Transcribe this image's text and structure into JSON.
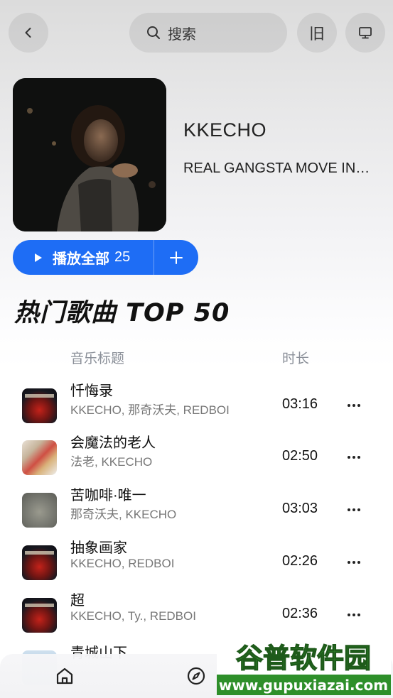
{
  "header": {
    "search_label": "搜索",
    "old_label": "旧",
    "icons": {
      "back": "chevron-left-icon",
      "search": "search-icon",
      "screen": "monitor-icon"
    }
  },
  "album": {
    "artist": "KKECHO",
    "title": "REAL GANGSTA MOVE IN…"
  },
  "play_all": {
    "label": "播放全部",
    "count": "25"
  },
  "section_title": "热门歌曲 TOP 50",
  "columns": {
    "title": "音乐标题",
    "duration": "时长"
  },
  "songs": [
    {
      "name": "忏悔录",
      "artists": "KKECHO, 那奇沃夫, REDBOI",
      "duration": "03:16"
    },
    {
      "name": "会魔法的老人",
      "artists": "法老, KKECHO",
      "duration": "02:50"
    },
    {
      "name": "苦咖啡·唯一",
      "artists": "那奇沃夫, KKECHO",
      "duration": "03:03"
    },
    {
      "name": "抽象画家",
      "artists": "KKECHO, REDBOI",
      "duration": "02:26"
    },
    {
      "name": "超",
      "artists": "KKECHO, Ty., REDBOI",
      "duration": "02:36"
    }
  ],
  "partial_song": {
    "name": "青城山下"
  },
  "watermark": {
    "title": "谷普软件园",
    "url": "www.gupuxiazai.com"
  },
  "colors": {
    "accent": "#1e6df5",
    "watermark_green": "#3aa634"
  }
}
